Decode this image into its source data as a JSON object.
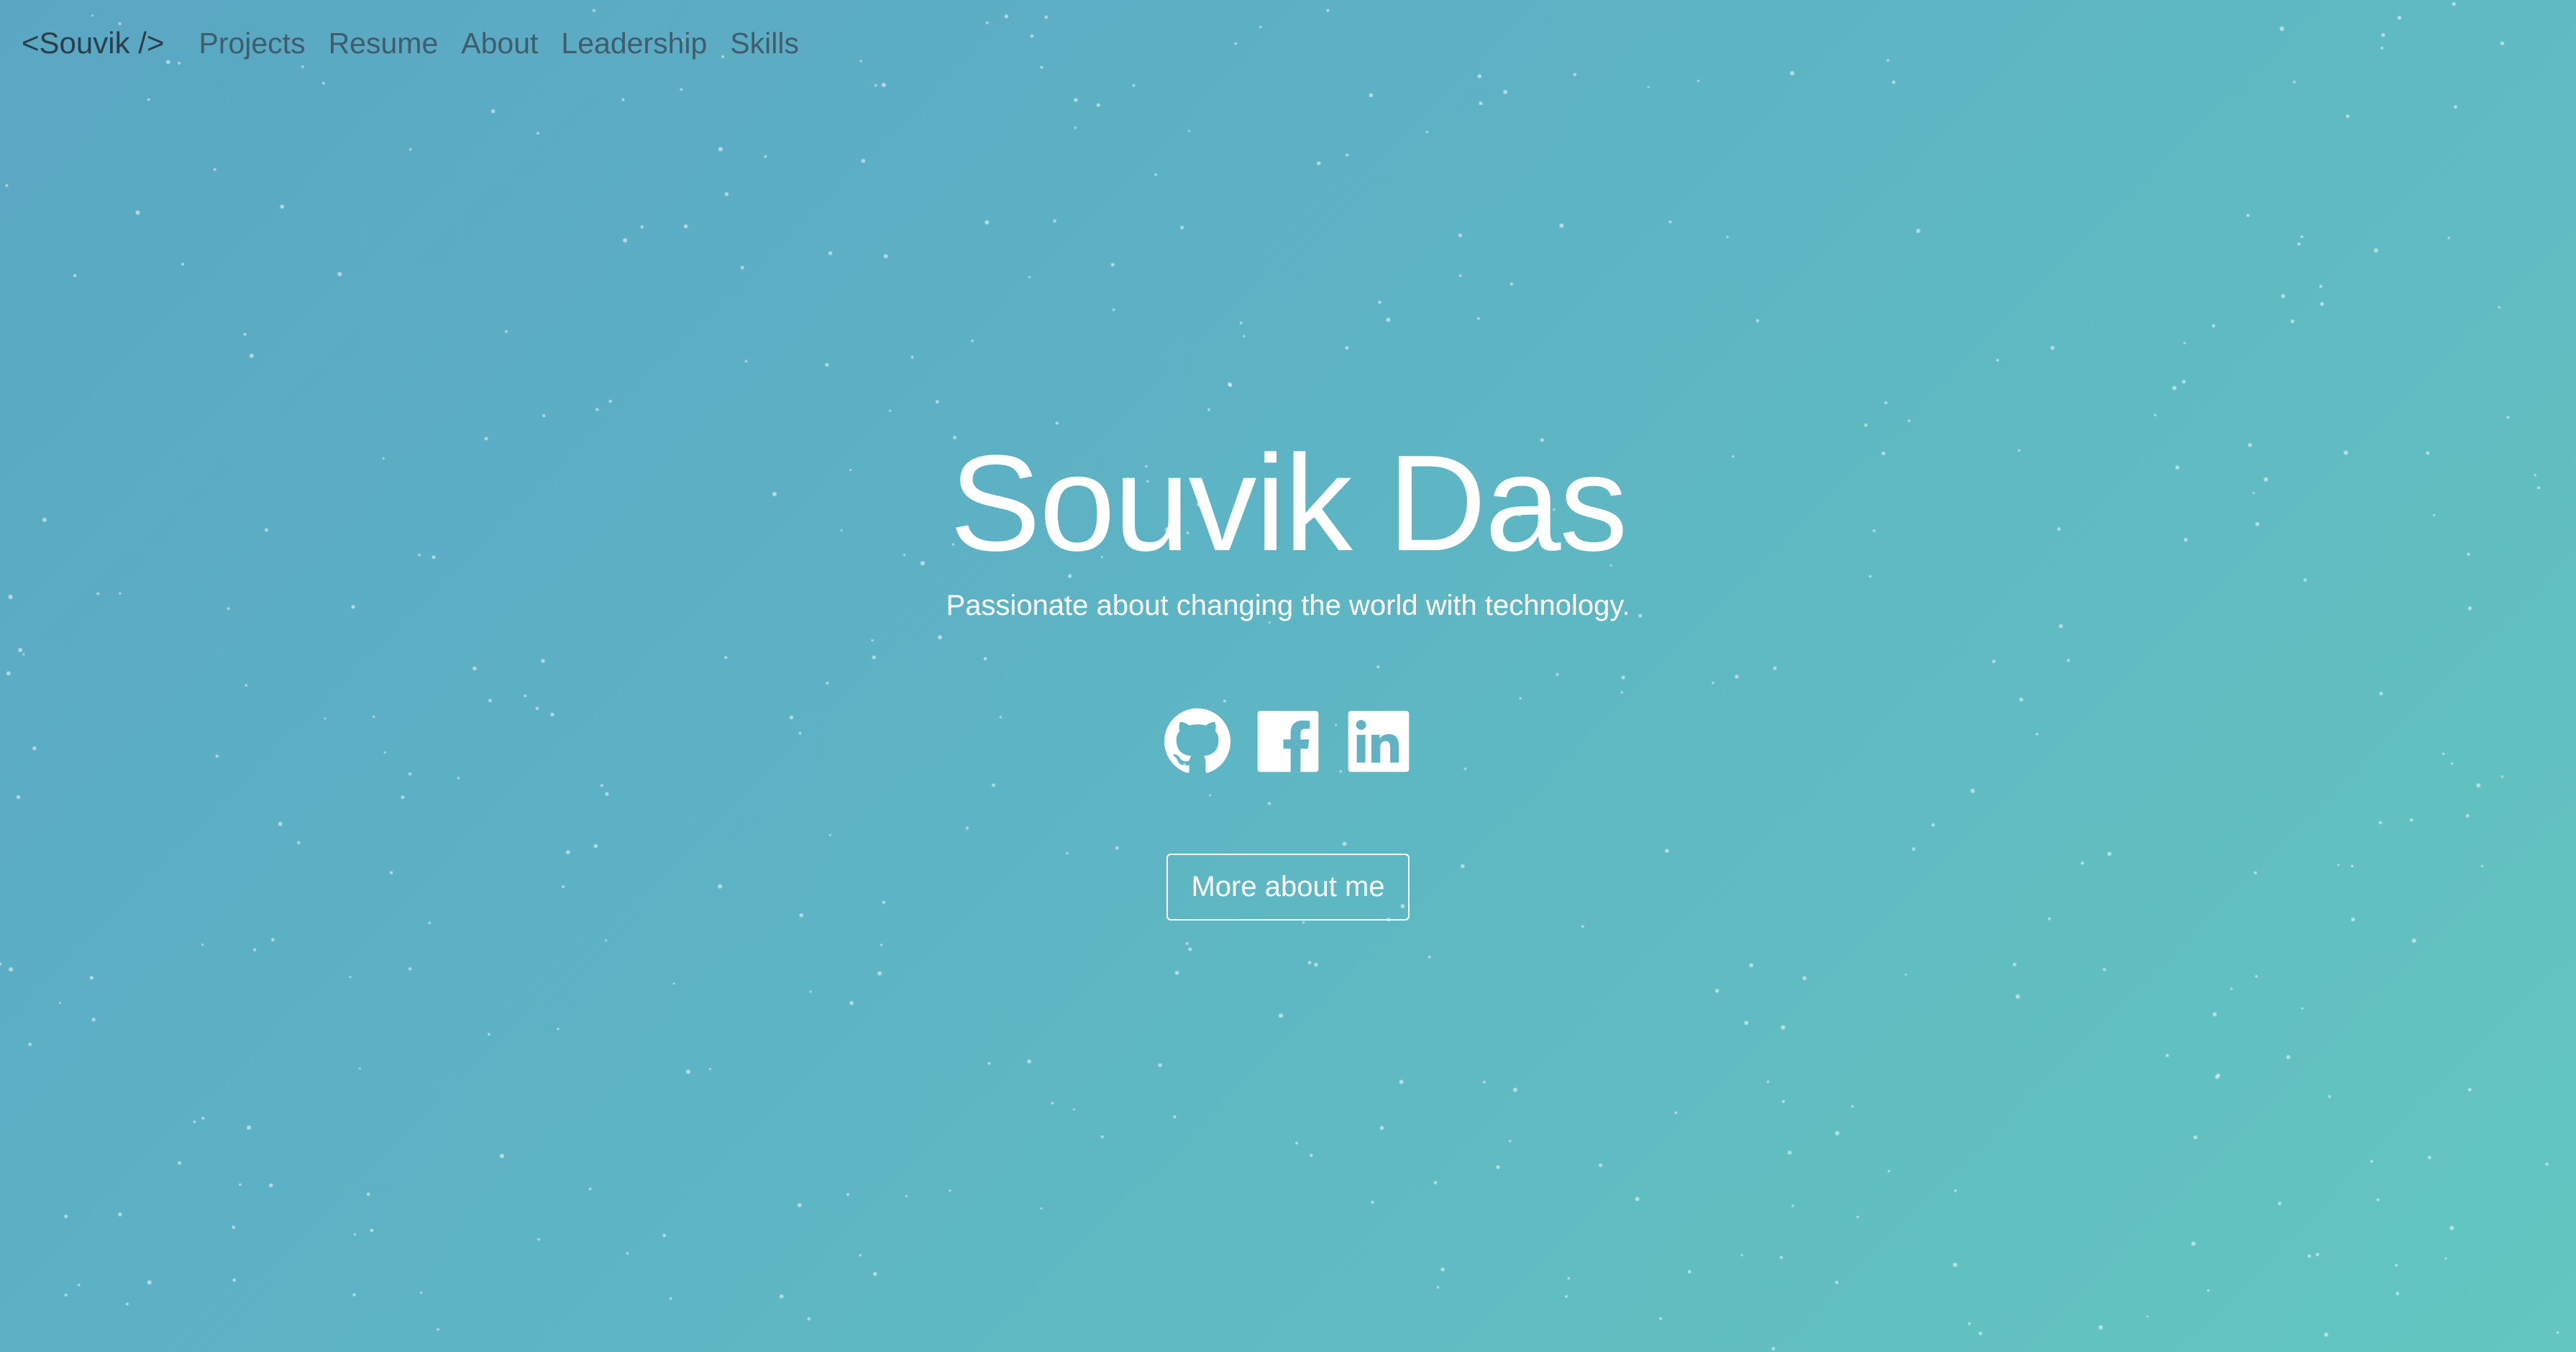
{
  "nav": {
    "brand": "<Souvik />",
    "links": [
      "Projects",
      "Resume",
      "About",
      "Leadership",
      "Skills"
    ]
  },
  "hero": {
    "title": "Souvik Das",
    "subtitle": "Passionate about changing the world with technology.",
    "button_label": "More about me"
  },
  "social": [
    {
      "name": "GitHub",
      "icon": "github-icon"
    },
    {
      "name": "Facebook",
      "icon": "facebook-icon"
    },
    {
      "name": "LinkedIn",
      "icon": "linkedin-icon"
    }
  ],
  "colors": {
    "gradient_start": "#5aa7c3",
    "gradient_end": "#63c6bf",
    "text_light": "#ffffff",
    "nav_text": "#3c5563",
    "brand_text": "#2d3e48"
  }
}
